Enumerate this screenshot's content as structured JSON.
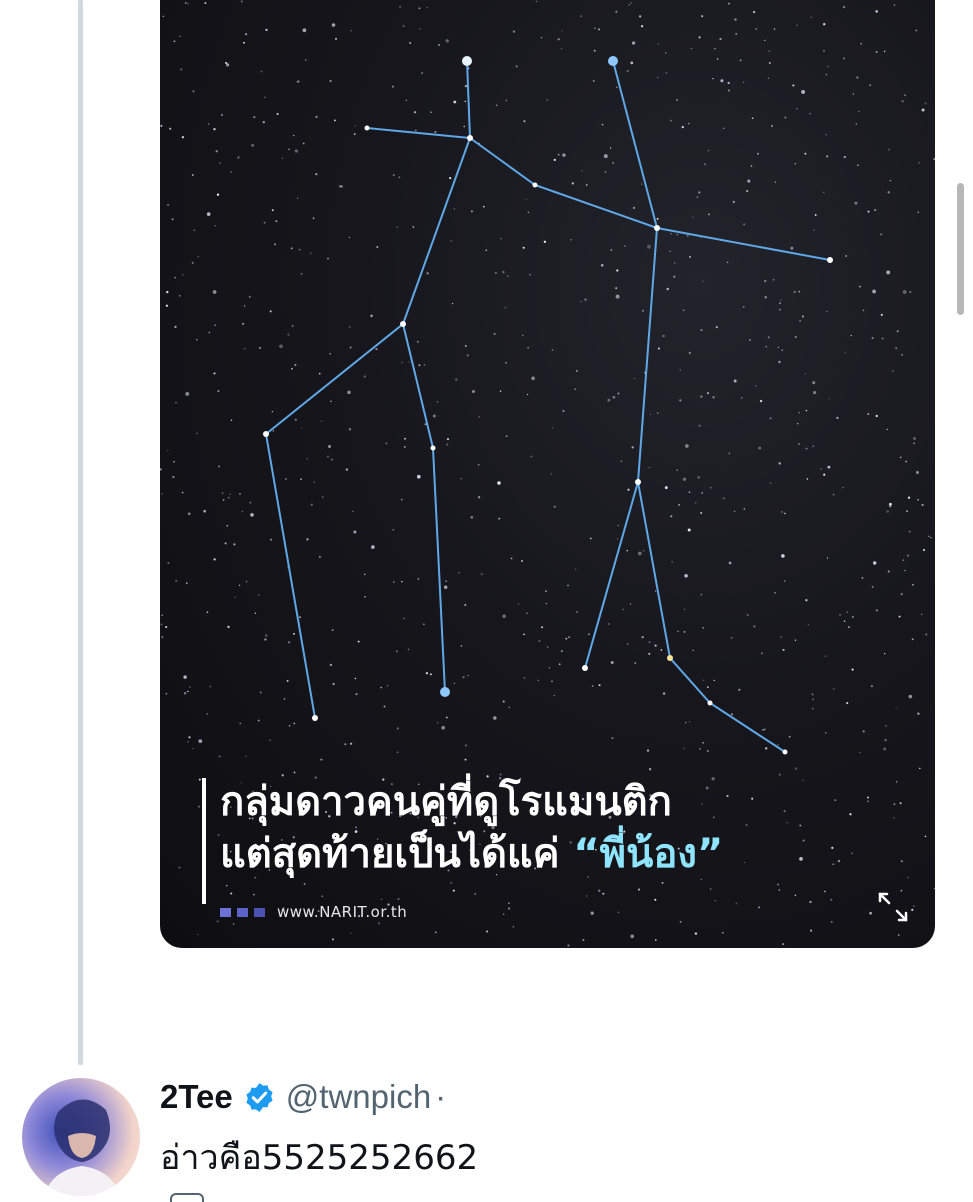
{
  "media": {
    "caption_line1": "กลุ่มดาวคนคู่ที่ดูโรแมนติก",
    "caption_line2_prefix": "แต่สุดท้ายเป็นได้แค่ ",
    "caption_quote": "“พี่น้อง”",
    "source": "www.NARIT.or.th",
    "expand_icon": "expand-arrows-icon"
  },
  "tweet": {
    "display_name": "2Tee",
    "verified": true,
    "handle": "@twnpich",
    "separator": "·",
    "text": "อ่าวคือ5525252662"
  },
  "colors": {
    "verified_blue": "#1d9bf0",
    "constellation_line": "#5fa8e8",
    "caption_accent": "#8fe4ff",
    "thread_line": "#cfd9de"
  }
}
